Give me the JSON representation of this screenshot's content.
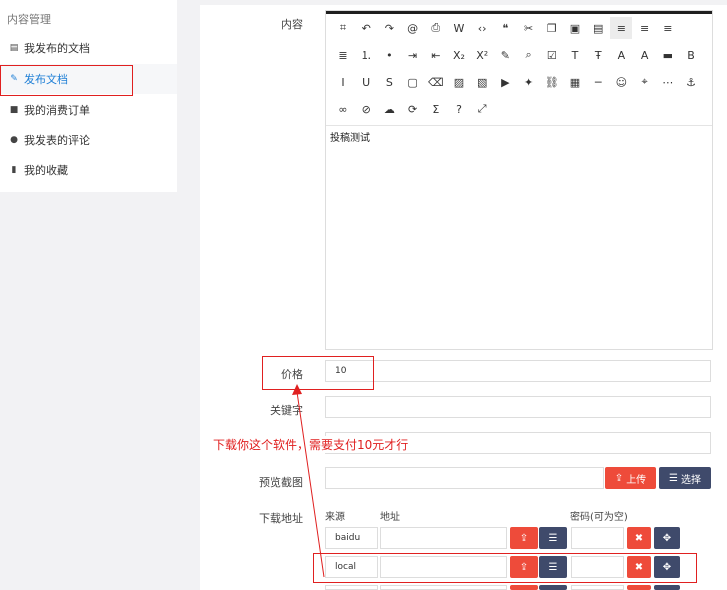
{
  "sidebar": {
    "title": "内容管理",
    "items": [
      {
        "label": "我发布的文档",
        "icon": "newspaper-icon"
      },
      {
        "label": "发布文档",
        "icon": "pencil-icon"
      },
      {
        "label": "我的消费订单",
        "icon": "bag-icon"
      },
      {
        "label": "我发表的评论",
        "icon": "comments-icon"
      },
      {
        "label": "我的收藏",
        "icon": "bookmark-icon"
      }
    ]
  },
  "form": {
    "content_label": "内容",
    "editor_text": "投稿测试",
    "price_label": "价格",
    "price_value": "10",
    "keywords_label": "关键字",
    "preview_label": "预览截图",
    "upload_label": "上传",
    "select_label": "选择",
    "download_label": "下载地址",
    "col_source": "来源",
    "col_address": "地址",
    "col_password": "密码(可为空)",
    "rows": [
      {
        "source": "baidu"
      },
      {
        "source": "local"
      }
    ]
  },
  "annotation": {
    "text": "下载你这个软件，需要支付10元才行"
  },
  "toolbar_icons": [
    "source-icon",
    "undo-icon",
    "redo-icon",
    "anchor-at-icon",
    "print-icon",
    "word-icon",
    "code-icon",
    "quote-icon",
    "cut-icon",
    "copy-icon",
    "paste-icon",
    "paste-text-icon",
    "align-left-icon",
    "align-center-icon",
    "align-right-icon",
    "justify-icon",
    "ordered-list-icon",
    "unordered-list-icon",
    "indent-icon",
    "outdent-icon",
    "subscript-icon",
    "superscript-icon",
    "format-brush-icon",
    "find-icon",
    "select-all-icon",
    "title-icon",
    "font-family-icon",
    "font-size-icon",
    "font-color-icon",
    "highlight-icon",
    "bold-icon",
    "italic-icon",
    "underline-icon",
    "strikethrough-icon",
    "border-icon",
    "eraser-icon",
    "image-icon",
    "multi-image-icon",
    "video-icon",
    "flash-icon",
    "link-icon",
    "table-icon",
    "hr-icon",
    "emoji-icon",
    "map-icon",
    "pagebreak-icon",
    "anchor-icon",
    "insert-link-icon",
    "unlink-icon",
    "upload-cloud-icon",
    "search-replace-icon",
    "formula-icon",
    "help-icon",
    "fullscreen-icon"
  ],
  "colors": {
    "accent_red": "#e02020",
    "upload_red": "#ee4b3a",
    "dark_button": "#3f4a6b",
    "active_blue": "#1e7fd6"
  }
}
